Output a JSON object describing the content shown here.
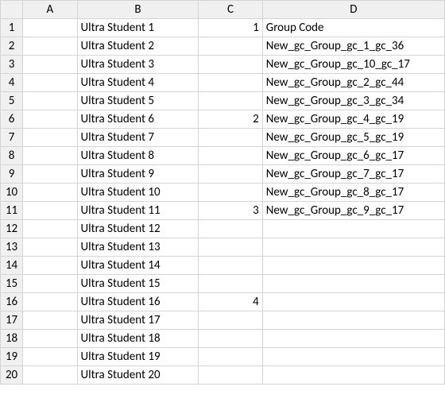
{
  "columns": [
    "A",
    "B",
    "C",
    "D"
  ],
  "rows": [
    {
      "n": "1",
      "A": "",
      "B": "Ultra Student 1",
      "C": "1",
      "D": "Group Code",
      "D_indent": false
    },
    {
      "n": "2",
      "A": "",
      "B": "Ultra Student 2",
      "C": "",
      "D": "New_gc_Group_gc_1_gc_36",
      "D_indent": true
    },
    {
      "n": "3",
      "A": "",
      "B": "Ultra Student 3",
      "C": "",
      "D": "New_gc_Group_gc_10_gc_17",
      "D_indent": true
    },
    {
      "n": "4",
      "A": "",
      "B": "Ultra Student 4",
      "C": "",
      "D": "New_gc_Group_gc_2_gc_44",
      "D_indent": true
    },
    {
      "n": "5",
      "A": "",
      "B": "Ultra Student 5",
      "C": "",
      "D": "New_gc_Group_gc_3_gc_34",
      "D_indent": true
    },
    {
      "n": "6",
      "A": "",
      "B": "Ultra Student 6",
      "C": "2",
      "D": "New_gc_Group_gc_4_gc_19",
      "D_indent": true
    },
    {
      "n": "7",
      "A": "",
      "B": "Ultra Student 7",
      "C": "",
      "D": "New_gc_Group_gc_5_gc_19",
      "D_indent": true
    },
    {
      "n": "8",
      "A": "",
      "B": "Ultra Student 8",
      "C": "",
      "D": "New_gc_Group_gc_6_gc_17",
      "D_indent": true
    },
    {
      "n": "9",
      "A": "",
      "B": "Ultra Student 9",
      "C": "",
      "D": "New_gc_Group_gc_7_gc_17",
      "D_indent": true
    },
    {
      "n": "10",
      "A": "",
      "B": "Ultra Student 10",
      "C": "",
      "D": "New_gc_Group_gc_8_gc_17",
      "D_indent": true
    },
    {
      "n": "11",
      "A": "",
      "B": "Ultra Student 11",
      "C": "3",
      "D": "New_gc_Group_gc_9_gc_17",
      "D_indent": true
    },
    {
      "n": "12",
      "A": "",
      "B": "Ultra Student 12",
      "C": "",
      "D": "",
      "D_indent": false
    },
    {
      "n": "13",
      "A": "",
      "B": "Ultra Student 13",
      "C": "",
      "D": "",
      "D_indent": false
    },
    {
      "n": "14",
      "A": "",
      "B": "Ultra Student 14",
      "C": "",
      "D": "",
      "D_indent": false
    },
    {
      "n": "15",
      "A": "",
      "B": "Ultra Student 15",
      "C": "",
      "D": "",
      "D_indent": false
    },
    {
      "n": "16",
      "A": "",
      "B": "Ultra Student 16",
      "C": "4",
      "D": "",
      "D_indent": false
    },
    {
      "n": "17",
      "A": "",
      "B": "Ultra Student 17",
      "C": "",
      "D": "",
      "D_indent": false
    },
    {
      "n": "18",
      "A": "",
      "B": "Ultra Student 18",
      "C": "",
      "D": "",
      "D_indent": false
    },
    {
      "n": "19",
      "A": "",
      "B": "Ultra Student 19",
      "C": "",
      "D": "",
      "D_indent": false
    },
    {
      "n": "20",
      "A": "",
      "B": "Ultra Student 20",
      "C": "",
      "D": "",
      "D_indent": false
    }
  ]
}
